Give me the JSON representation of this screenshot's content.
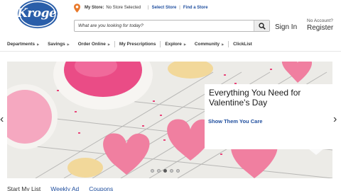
{
  "brand": {
    "logo_text": "Kroger",
    "color": "#2a5ea9"
  },
  "store": {
    "label": "My Store:",
    "value": "No Store Selected",
    "select_link": "Select Store",
    "find_link": "Find a Store"
  },
  "search": {
    "placeholder": "What are you looking for today?"
  },
  "account": {
    "sign_in": "Sign In",
    "no_account": "No Account?",
    "register": "Register"
  },
  "nav": {
    "items": [
      {
        "label": "Departments",
        "caret": "▶"
      },
      {
        "label": "Savings",
        "caret": "▶"
      },
      {
        "label": "Order Online",
        "caret": "▶"
      },
      {
        "label": "My Prescriptions",
        "caret": ""
      },
      {
        "label": "Explore",
        "caret": "▶"
      },
      {
        "label": "Community",
        "caret": "▶"
      },
      {
        "label": "ClickList",
        "caret": ""
      }
    ]
  },
  "hero": {
    "title": "Everything You Need for Valentine's Day",
    "link": "Show Them You Care",
    "prev": "‹",
    "next": "›",
    "slide_count": 5,
    "active_slide": 2
  },
  "bottom_tabs": {
    "start_list": "Start My List",
    "weekly_ad": "Weekly Ad",
    "coupons": "Coupons"
  },
  "colors": {
    "link": "#1f4e9e",
    "pin": "#e8792b",
    "pink": "#f07fa0"
  }
}
